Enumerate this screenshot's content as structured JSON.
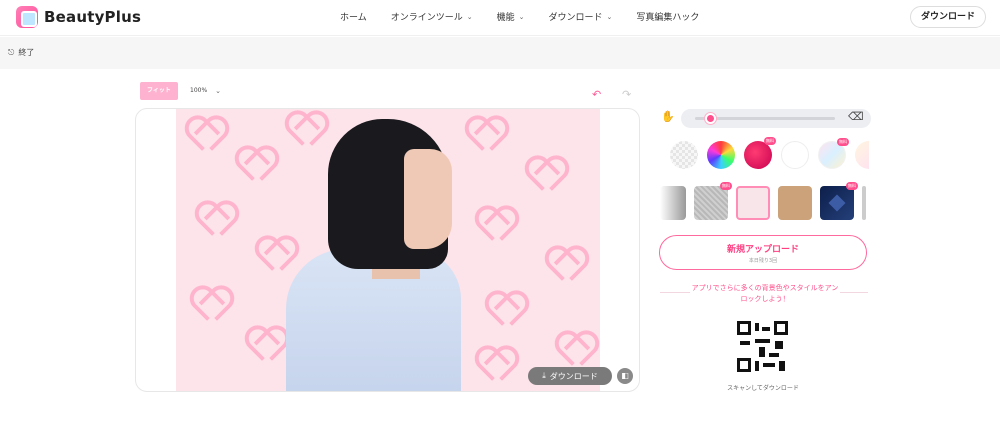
{
  "header": {
    "brand": "BeautyPlus",
    "nav": [
      {
        "label": "ホーム",
        "has_menu": false
      },
      {
        "label": "オンラインツール",
        "has_menu": true
      },
      {
        "label": "機能",
        "has_menu": true
      },
      {
        "label": "ダウンロード",
        "has_menu": true
      },
      {
        "label": "写真編集ハック",
        "has_menu": false
      }
    ],
    "download_label": "ダウンロード"
  },
  "exitbar": {
    "exit_label": "終了"
  },
  "editor": {
    "fit_label": "フィット",
    "zoom_value": "100%",
    "download_label": "ダウンロード"
  },
  "panel": {
    "badge_label": "無料",
    "upload": {
      "title": "新規アップロード",
      "subtitle": "本日残り3回"
    },
    "promo": "アプリでさらに多くの背景色やスタイルをアンロックしよう！",
    "qr_caption": "スキャンしてダウンロード"
  },
  "colors": {
    "accent": "#ff4f8c",
    "fit_button": "#ffb2cf",
    "photo_bg": "#fde3ea"
  }
}
